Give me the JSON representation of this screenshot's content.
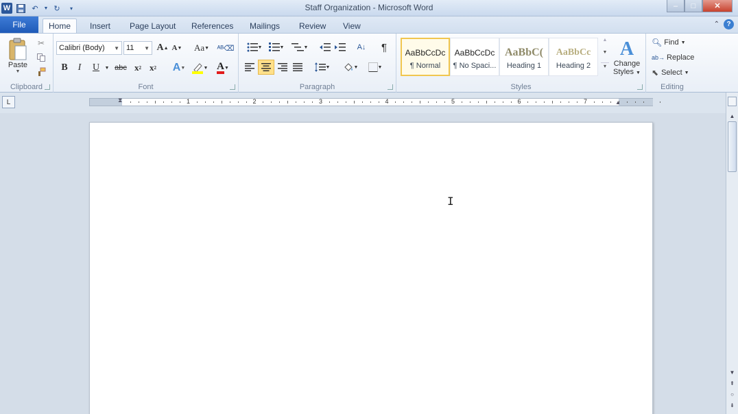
{
  "window": {
    "title": "Staff Organization  -  Microsoft Word",
    "logo_letter": "W"
  },
  "tabs": [
    {
      "label": "File"
    },
    {
      "label": "Home"
    },
    {
      "label": "Insert"
    },
    {
      "label": "Page Layout"
    },
    {
      "label": "References"
    },
    {
      "label": "Mailings"
    },
    {
      "label": "Review"
    },
    {
      "label": "View"
    }
  ],
  "help_label": "?",
  "clipboard": {
    "label": "Clipboard",
    "paste_label": "Paste"
  },
  "font": {
    "label": "Font",
    "name": "Calibri (Body)",
    "size": "11",
    "grow": "A",
    "shrink": "A",
    "case": "Aa",
    "bold": "B",
    "italic": "I",
    "underline": "U",
    "strike": "abc",
    "subscript": "x",
    "superscript": "x",
    "color": "A"
  },
  "paragraph": {
    "label": "Paragraph",
    "sort": "A↓",
    "pilcrow": "¶"
  },
  "styles": {
    "label": "Styles",
    "items": [
      {
        "preview": "AaBbCcDc",
        "name": "¶ Normal"
      },
      {
        "preview": "AaBbCcDc",
        "name": "¶ No Spaci..."
      },
      {
        "preview": "AaBbC(",
        "name": "Heading 1"
      },
      {
        "preview": "AaBbCc",
        "name": "Heading 2"
      }
    ],
    "change_styles_1": "Change",
    "change_styles_2": "Styles"
  },
  "editing": {
    "label": "Editing",
    "find": "Find",
    "replace": "Replace",
    "select": "Select"
  },
  "ruler": {
    "numbers": [
      "1",
      "2",
      "3",
      "4",
      "5",
      "6",
      "7"
    ]
  },
  "colors": {
    "file_tab": "#2b5fb8",
    "style_selected_border": "#f1c64f",
    "heading1": "#8f8a68",
    "heading2": "#b8ae7f"
  }
}
